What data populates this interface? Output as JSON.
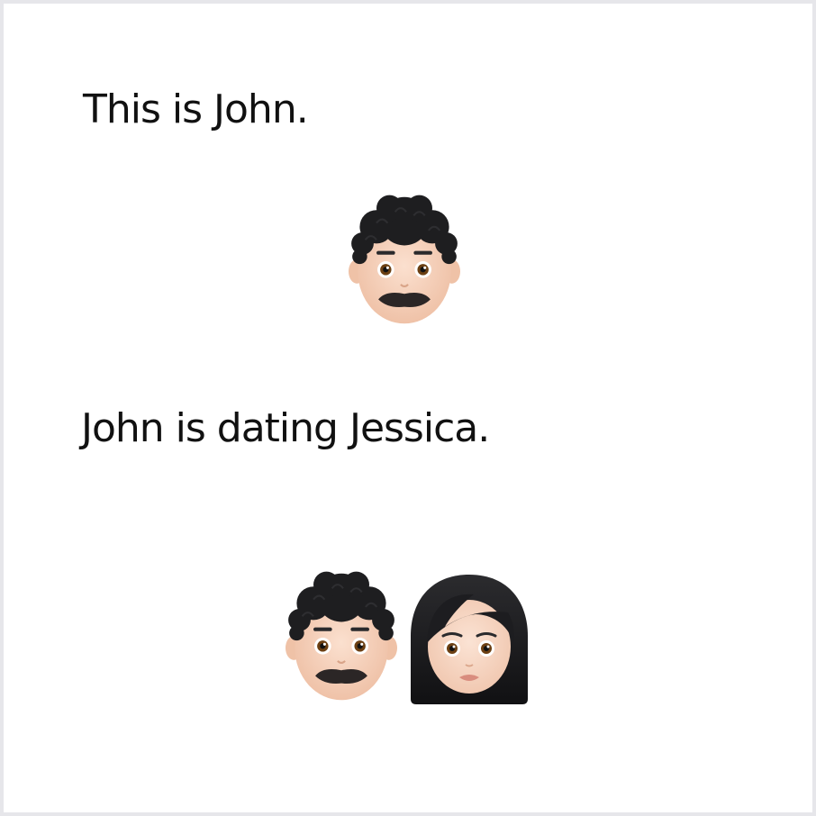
{
  "captions": {
    "first": "This is John.",
    "second": "John is dating Jessica."
  },
  "figures": {
    "john_single": {
      "icon": "man-curly-hair-mustache-emoji"
    },
    "john_pair": {
      "icon": "man-curly-hair-mustache-emoji"
    },
    "jessica": {
      "icon": "woman-long-black-hair-emoji"
    }
  },
  "colors": {
    "background": "#ffffff",
    "frame": "#e6e6ea",
    "text": "#111111",
    "skin": "#f6d2bd",
    "hair": "#1c1c1e"
  }
}
